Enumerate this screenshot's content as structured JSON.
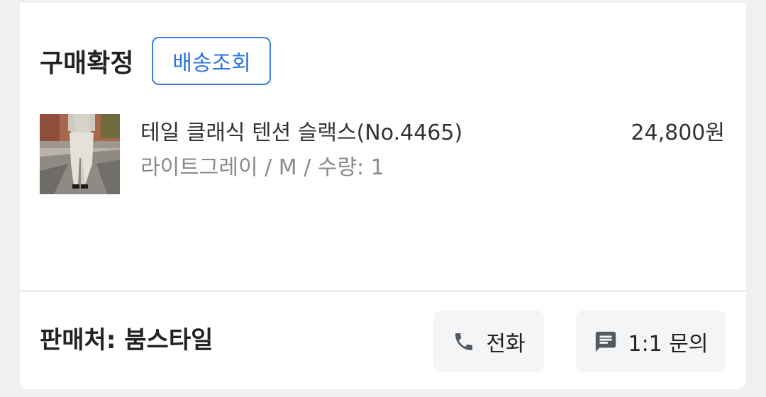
{
  "order": {
    "status_label": "구매확정",
    "track_button_label": "배송조회"
  },
  "product": {
    "name": "테일 클래식 텐션 슬랙스(No.4465)",
    "option_line": "라이트그레이 / M  / 수량: 1",
    "price": "24,800원",
    "image_icon": "product-photo"
  },
  "seller": {
    "label": "판매처: 붐스타일"
  },
  "actions": {
    "call_label": "전화",
    "call_icon": "phone-icon",
    "inquiry_label": "1:1 문의",
    "inquiry_icon": "chat-icon"
  },
  "colors": {
    "accent": "#3d7ee0",
    "button_bg": "#f4f5f7",
    "page_bg": "#eef0f2"
  }
}
